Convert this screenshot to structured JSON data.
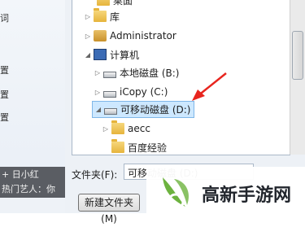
{
  "left_panel": {
    "items": [
      "词",
      "置",
      "置",
      "置"
    ],
    "dark_lines": [
      "+ 日小红",
      "热门艺人：你"
    ]
  },
  "tree": {
    "partial_top_label": "桌面",
    "nodes": [
      {
        "label": "库",
        "icon": "library-folder-icon"
      },
      {
        "label": "Administrator",
        "icon": "user-folder-icon"
      },
      {
        "label": "计算机",
        "icon": "computer-icon"
      },
      {
        "label": "本地磁盘 (B:)",
        "icon": "hard-drive-icon"
      },
      {
        "label": "iCopy (C:)",
        "icon": "system-drive-icon"
      },
      {
        "label": "可移动磁盘 (D:)",
        "icon": "removable-drive-icon",
        "selected": true
      },
      {
        "label": "aecc",
        "icon": "folder-icon"
      },
      {
        "label": "百度经验",
        "icon": "folder-icon"
      }
    ]
  },
  "footer": {
    "folder_label": "文件夹(F):",
    "folder_value": "可移动磁盘 (D:)",
    "new_folder_button": "新建文件夹(M)"
  },
  "annotation": {
    "color": "#e8251e"
  },
  "watermark": {
    "text": "高新手游网",
    "color": "#6db33f"
  }
}
